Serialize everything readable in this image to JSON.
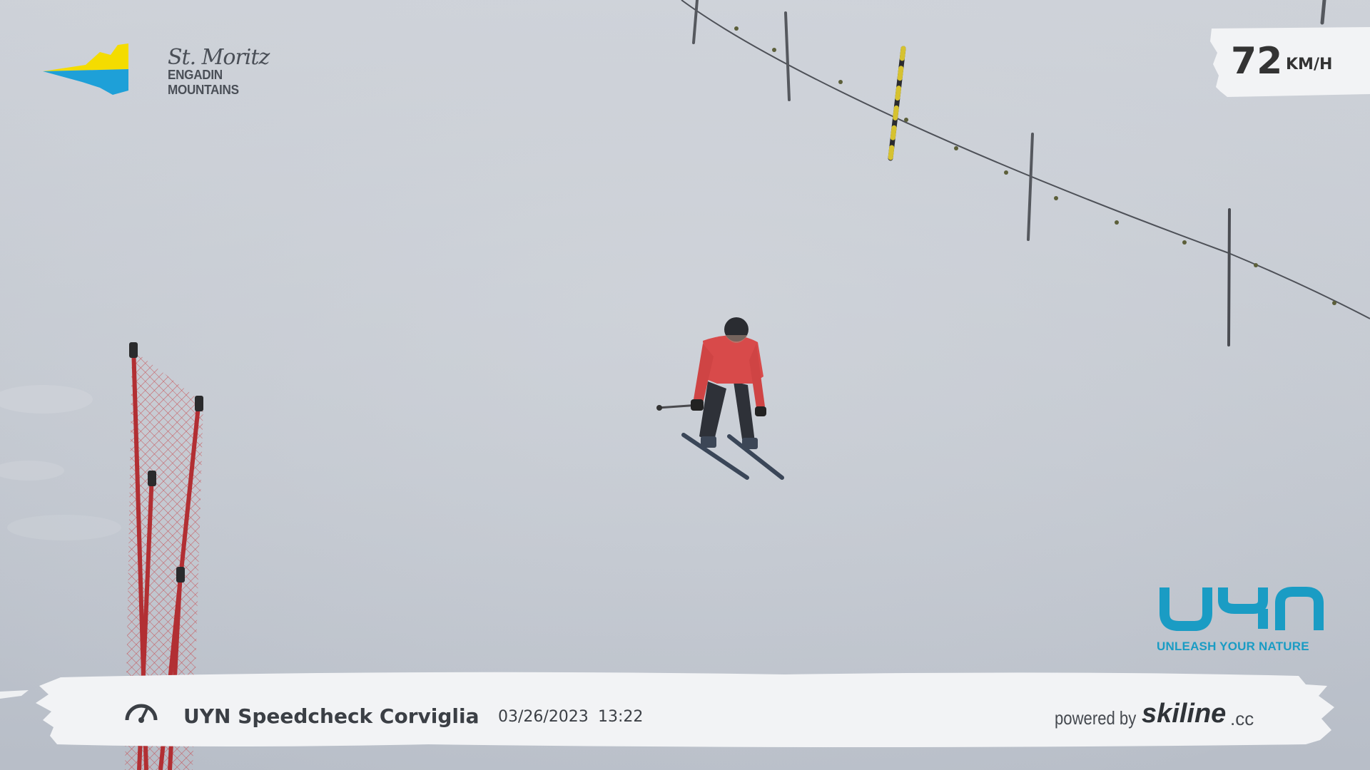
{
  "branding": {
    "resort_script": "St. Moritz",
    "resort_name": "ENGADIN MOUNTAINS",
    "sponsor_name": "UYN",
    "sponsor_tagline": "UNLEASH YOUR NATURE",
    "powered_by": "powered by",
    "provider_name": "skiline",
    "provider_tld": ".cc"
  },
  "speed": {
    "value": "72",
    "unit": "KM/H"
  },
  "camera": {
    "name": "UYN Speedcheck Corviglia",
    "date": "03/26/2023",
    "time": "13:22"
  },
  "colors": {
    "snow": "#c9ced6",
    "jacket": "#d84a4a",
    "net": "#c23a3a",
    "uyn_blue": "#1a9cc4",
    "banner": "#f2f3f5",
    "text_dark": "#3b3f45"
  },
  "icons": [
    "speedometer-icon",
    "stmoritz-logo",
    "uyn-logo"
  ]
}
